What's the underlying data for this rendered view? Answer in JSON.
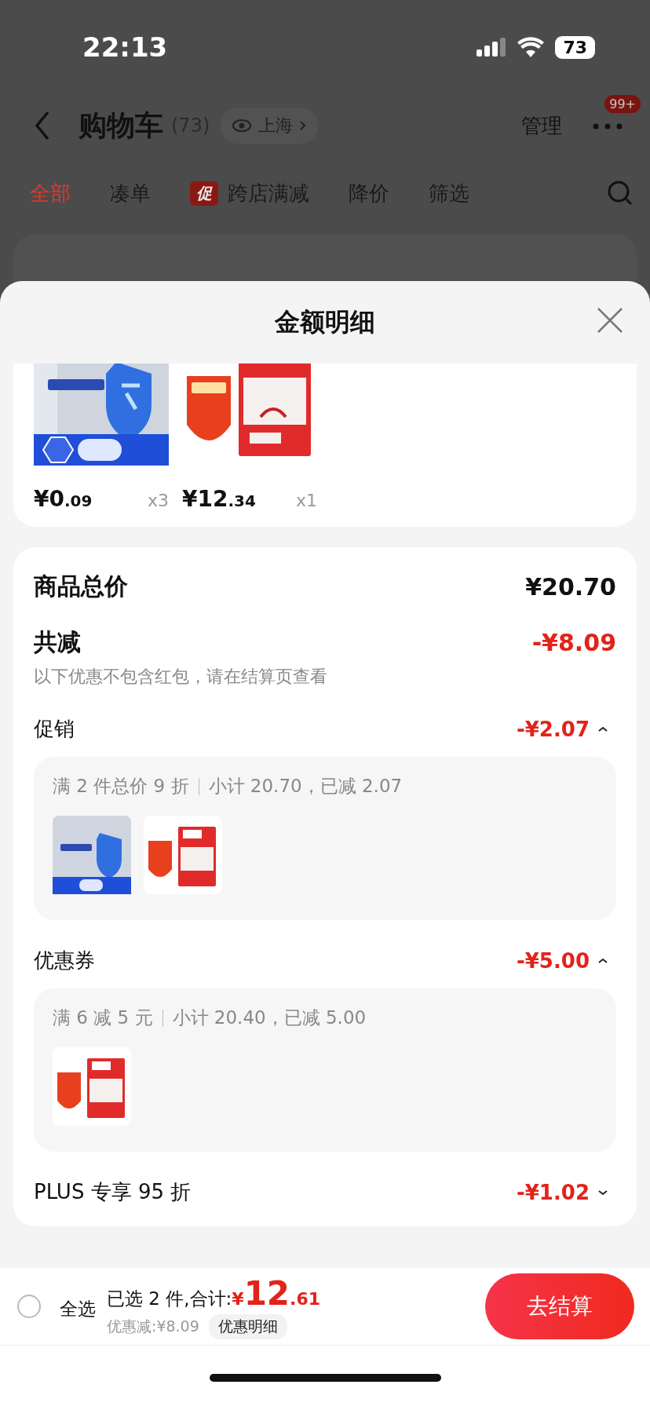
{
  "status_bar": {
    "time": "22:13",
    "battery": "73"
  },
  "nav": {
    "title": "购物车",
    "count": "(73)",
    "location": "上海",
    "manage": "管理",
    "more_badge": "99+"
  },
  "tabs": [
    {
      "label": "全部",
      "selected": true
    },
    {
      "label": "凑单",
      "selected": false
    },
    {
      "label": "跨店满减",
      "selected": false,
      "badge": "促"
    },
    {
      "label": "降价",
      "selected": false
    },
    {
      "label": "筛选",
      "selected": false
    }
  ],
  "sheet": {
    "title": "金额明细",
    "products": [
      {
        "price": "¥0",
        "cents": ".09",
        "qty": "x3"
      },
      {
        "price": "¥12",
        "cents": ".34",
        "qty": "x1"
      }
    ],
    "total": {
      "label": "商品总价",
      "value": "¥20.70"
    },
    "reduction": {
      "label": "共减",
      "value": "-¥8.09",
      "note": "以下优惠不包含红包，请在结算页查看"
    },
    "discounts": [
      {
        "label": "促销",
        "value": "-¥2.07",
        "expanded": true,
        "rule": "满 2 件总价 9 折",
        "detail": "小计 20.70，已减 2.07"
      },
      {
        "label": "优惠券",
        "value": "-¥5.00",
        "expanded": true,
        "rule": "满 6 减 5 元",
        "detail": "小计 20.40，已减 5.00"
      },
      {
        "label": "PLUS 专享 95 折",
        "value": "-¥1.02",
        "expanded": false
      }
    ]
  },
  "footer": {
    "select_all": {
      "label": "全选",
      "checked": false
    },
    "summary": "已选 2 件,合计:",
    "currency": "¥",
    "amount": "12",
    "cents": ".61",
    "saved": "优惠减:¥8.09",
    "details": "优惠明细",
    "checkout": "去结算"
  }
}
